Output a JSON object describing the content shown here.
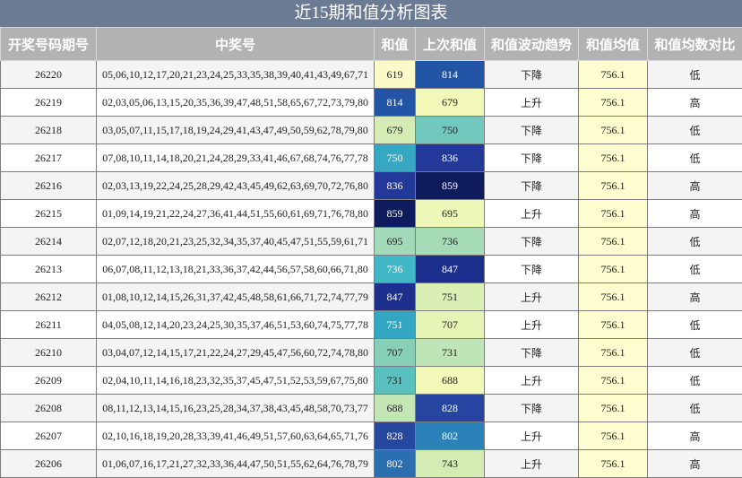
{
  "title": "近15期和值分析图表",
  "headers": [
    "开奖号码期号",
    "中奖号",
    "和值",
    "上次和值",
    "和值波动趋势",
    "和值均值",
    "和值均数对比"
  ],
  "colors": {
    "title_bg": "#6b7b93",
    "header_bg": "#b2b2b2",
    "avg_bg": "#fdfdd0"
  },
  "rows": [
    {
      "issue": "26220",
      "numbers": "05,06,10,12,17,20,21,23,24,25,33,35,38,39,40,41,43,49,67,71",
      "sum": "619",
      "sum_color": "#fafbc8",
      "prev_sum": "814",
      "prev_color": "#2255a5",
      "trend": "下降",
      "avg": "756.1",
      "compare": "低"
    },
    {
      "issue": "26219",
      "numbers": "02,03,05,06,13,15,20,35,36,39,47,48,51,58,65,67,72,73,79,80",
      "sum": "814",
      "sum_color": "#2255a5",
      "prev_sum": "679",
      "prev_color": "#f2f9b8",
      "trend": "上升",
      "avg": "756.1",
      "compare": "高"
    },
    {
      "issue": "26218",
      "numbers": "03,05,07,11,15,17,18,19,24,29,41,43,47,49,50,59,62,78,79,80",
      "sum": "679",
      "sum_color": "#d4ecb3",
      "prev_sum": "750",
      "prev_color": "#72c8bd",
      "trend": "下降",
      "avg": "756.1",
      "compare": "低"
    },
    {
      "issue": "26217",
      "numbers": "07,08,10,11,14,18,20,21,24,28,29,33,41,46,67,68,74,76,77,78",
      "sum": "750",
      "sum_color": "#36a8c2",
      "prev_sum": "836",
      "prev_color": "#23399a",
      "trend": "下降",
      "avg": "756.1",
      "compare": "低"
    },
    {
      "issue": "26216",
      "numbers": "02,03,13,19,22,24,25,28,29,42,43,45,49,62,63,69,70,72,76,80",
      "sum": "836",
      "sum_color": "#23399a",
      "prev_sum": "859",
      "prev_color": "#0e1b5c",
      "trend": "下降",
      "avg": "756.1",
      "compare": "高"
    },
    {
      "issue": "26215",
      "numbers": "01,09,14,19,21,22,24,27,36,41,44,51,55,60,61,69,71,76,78,80",
      "sum": "859",
      "sum_color": "#0e1b5c",
      "prev_sum": "695",
      "prev_color": "#eef8b9",
      "trend": "上升",
      "avg": "756.1",
      "compare": "高"
    },
    {
      "issue": "26214",
      "numbers": "02,07,12,18,20,21,23,25,32,34,35,37,40,45,47,51,55,59,61,71",
      "sum": "695",
      "sum_color": "#a2d9b8",
      "prev_sum": "736",
      "prev_color": "#a5dbb7",
      "trend": "下降",
      "avg": "756.1",
      "compare": "低"
    },
    {
      "issue": "26213",
      "numbers": "06,07,08,11,12,13,18,21,33,36,37,42,44,56,57,58,60,66,71,80",
      "sum": "736",
      "sum_color": "#3fb7c4",
      "prev_sum": "847",
      "prev_color": "#1d2f8c",
      "trend": "下降",
      "avg": "756.1",
      "compare": "低"
    },
    {
      "issue": "26212",
      "numbers": "01,08,10,12,14,15,26,31,37,42,45,48,58,61,66,71,72,74,77,79",
      "sum": "847",
      "sum_color": "#1d2f8c",
      "prev_sum": "751",
      "prev_color": "#d9efb4",
      "trend": "上升",
      "avg": "756.1",
      "compare": "高"
    },
    {
      "issue": "26211",
      "numbers": "04,05,08,12,14,20,23,24,25,30,35,37,46,51,53,60,74,75,77,78",
      "sum": "751",
      "sum_color": "#33a6c2",
      "prev_sum": "707",
      "prev_color": "#e6f5b6",
      "trend": "上升",
      "avg": "756.1",
      "compare": "低"
    },
    {
      "issue": "26210",
      "numbers": "03,04,07,12,14,15,17,21,22,24,27,29,45,47,56,60,72,74,78,80",
      "sum": "707",
      "sum_color": "#88cfb9",
      "prev_sum": "731",
      "prev_color": "#bfe4b5",
      "trend": "下降",
      "avg": "756.1",
      "compare": "低"
    },
    {
      "issue": "26209",
      "numbers": "02,04,10,11,14,16,18,23,32,35,37,45,47,51,52,53,59,67,75,80",
      "sum": "731",
      "sum_color": "#5bc1c0",
      "prev_sum": "688",
      "prev_color": "#f2f9b8",
      "trend": "上升",
      "avg": "756.1",
      "compare": "低"
    },
    {
      "issue": "26208",
      "numbers": "08,11,12,13,14,15,16,23,25,28,34,37,38,43,45,48,58,70,73,77",
      "sum": "688",
      "sum_color": "#c3e6b4",
      "prev_sum": "828",
      "prev_color": "#2545a0",
      "trend": "下降",
      "avg": "756.1",
      "compare": "低"
    },
    {
      "issue": "26207",
      "numbers": "02,10,16,18,19,20,28,33,39,41,46,49,51,57,60,63,64,65,71,76",
      "sum": "828",
      "sum_color": "#26489f",
      "prev_sum": "802",
      "prev_color": "#2b82b9",
      "trend": "上升",
      "avg": "756.1",
      "compare": "高"
    },
    {
      "issue": "26206",
      "numbers": "01,06,07,16,17,21,27,32,33,36,44,47,50,51,55,62,64,76,78,79",
      "sum": "802",
      "sum_color": "#2b6fb0",
      "prev_sum": "743",
      "prev_color": "#d4ecb3",
      "trend": "上升",
      "avg": "756.1",
      "compare": "高"
    }
  ]
}
